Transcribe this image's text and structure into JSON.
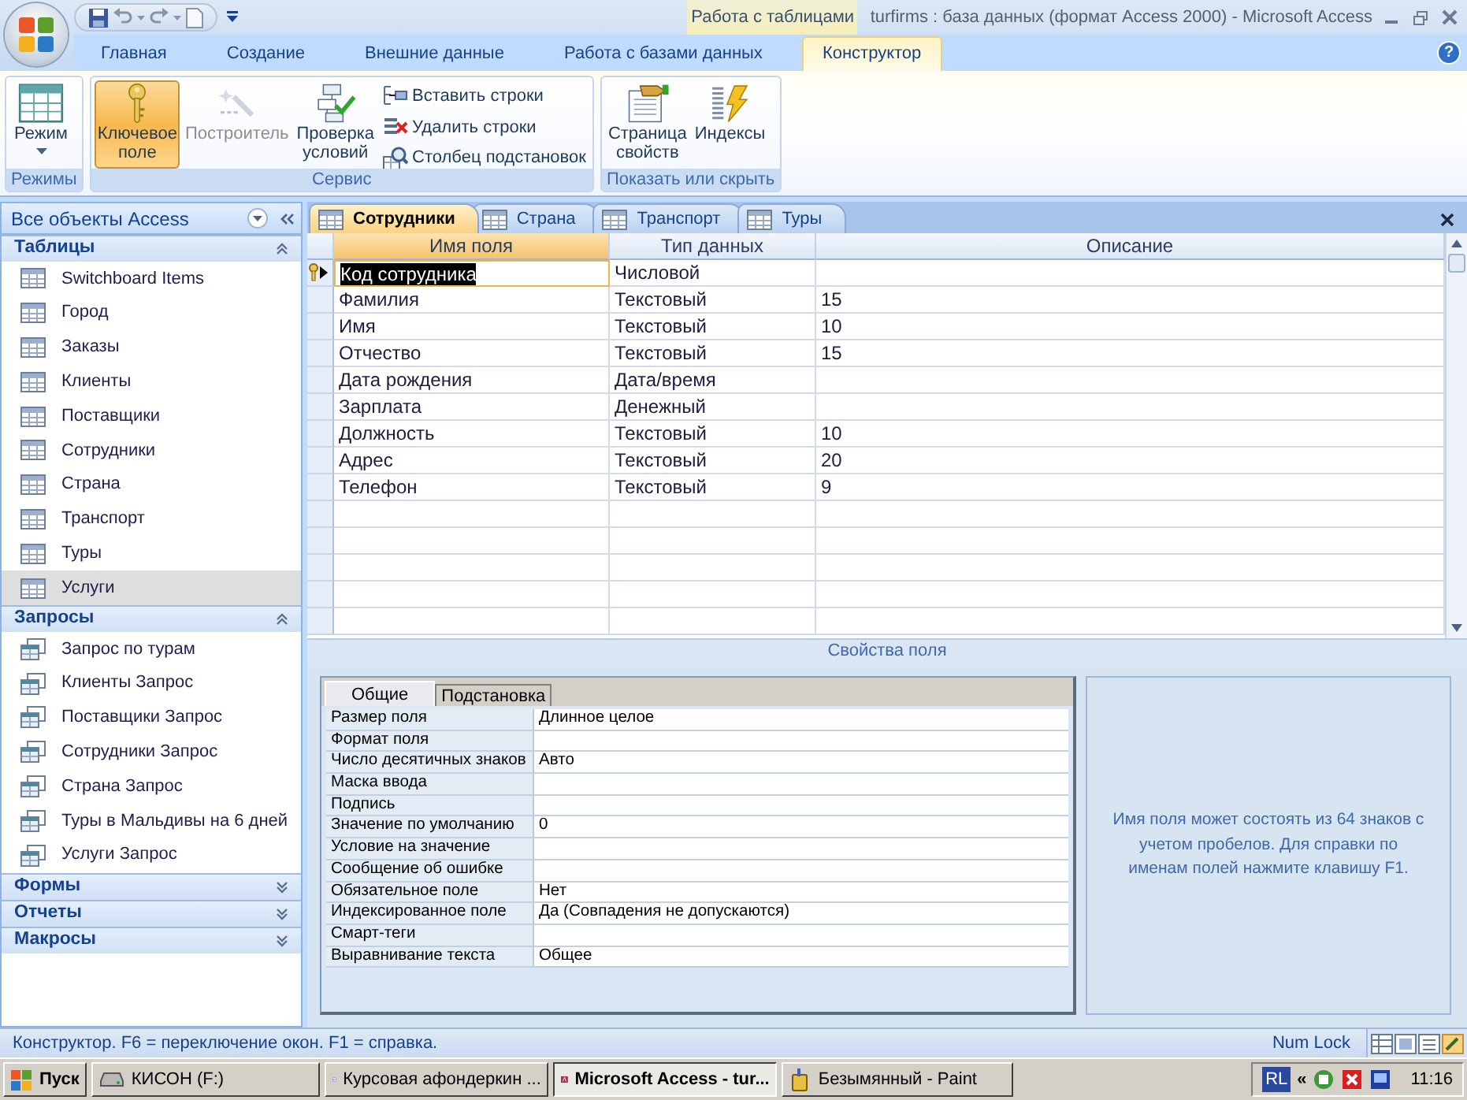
{
  "window": {
    "title": "turfirms : база данных (формат Access 2000) - Microsoft Access",
    "context_group": "Работа с таблицами",
    "help_button": "?"
  },
  "ribbon_tabs": [
    {
      "label": "Главная",
      "selected": false
    },
    {
      "label": "Создание",
      "selected": false
    },
    {
      "label": "Внешние данные",
      "selected": false
    },
    {
      "label": "Работа с базами данных",
      "selected": false
    },
    {
      "label": "Конструктор",
      "selected": true
    }
  ],
  "ribbon_groups": [
    {
      "label": "Режимы",
      "buttons": [
        {
          "label": "Режим",
          "kind": "large",
          "dropdown": true,
          "pressed": false,
          "disabled": false
        }
      ]
    },
    {
      "label": "Сервис",
      "buttons": [
        {
          "label": "Ключевое поле",
          "kind": "large",
          "pressed": true,
          "disabled": false
        },
        {
          "label": "Построитель",
          "kind": "large",
          "pressed": false,
          "disabled": true
        },
        {
          "label": "Проверка условий",
          "kind": "large",
          "pressed": false,
          "disabled": false
        },
        {
          "label": "Вставить строки",
          "kind": "small",
          "pressed": false,
          "disabled": false
        },
        {
          "label": "Удалить строки",
          "kind": "small",
          "pressed": false,
          "disabled": false
        },
        {
          "label": "Столбец подстановок",
          "kind": "small",
          "pressed": false,
          "disabled": false
        }
      ]
    },
    {
      "label": "Показать или скрыть",
      "buttons": [
        {
          "label": "Страница свойств",
          "kind": "large",
          "pressed": false,
          "disabled": false
        },
        {
          "label": "Индексы",
          "kind": "large",
          "pressed": false,
          "disabled": false
        }
      ]
    }
  ],
  "nav_pane": {
    "title": "Все объекты Access",
    "groups": [
      {
        "label": "Таблицы",
        "kind": "table",
        "expanded": true,
        "items": [
          {
            "label": "Switchboard Items",
            "selected": false
          },
          {
            "label": "Город",
            "selected": false
          },
          {
            "label": "Заказы",
            "selected": false
          },
          {
            "label": "Клиенты",
            "selected": false
          },
          {
            "label": "Поставщики",
            "selected": false
          },
          {
            "label": "Сотрудники",
            "selected": false
          },
          {
            "label": "Страна",
            "selected": false
          },
          {
            "label": "Транспорт",
            "selected": false
          },
          {
            "label": "Туры",
            "selected": false
          },
          {
            "label": "Услуги",
            "selected": true
          }
        ]
      },
      {
        "label": "Запросы",
        "kind": "query",
        "expanded": true,
        "items": [
          {
            "label": "Запрос по турам",
            "selected": false
          },
          {
            "label": "Клиенты Запрос",
            "selected": false
          },
          {
            "label": "Поставщики Запрос",
            "selected": false
          },
          {
            "label": "Сотрудники Запрос",
            "selected": false
          },
          {
            "label": "Страна Запрос",
            "selected": false
          },
          {
            "label": "Туры в Мальдивы на 6 дней",
            "selected": false
          },
          {
            "label": "Услуги Запрос",
            "selected": false
          }
        ]
      },
      {
        "label": "Формы",
        "expanded": false
      },
      {
        "label": "Отчеты",
        "expanded": false
      },
      {
        "label": "Макросы",
        "expanded": false
      }
    ]
  },
  "document_tabs": [
    {
      "label": "Сотрудники",
      "selected": true
    },
    {
      "label": "Страна",
      "selected": false
    },
    {
      "label": "Транспорт",
      "selected": false
    },
    {
      "label": "Туры",
      "selected": false
    }
  ],
  "design_grid": {
    "columns": [
      {
        "label": "Имя поля",
        "selected": true
      },
      {
        "label": "Тип данных",
        "selected": false
      },
      {
        "label": "Описание",
        "selected": false
      }
    ],
    "rows": [
      {
        "cells": [
          "Код сотрудника",
          "Числовой",
          ""
        ],
        "primary_key": true,
        "current": true
      },
      {
        "cells": [
          "Фамилия",
          "Текстовый",
          "15"
        ],
        "primary_key": false,
        "current": false
      },
      {
        "cells": [
          "Имя",
          "Текстовый",
          "10"
        ],
        "primary_key": false,
        "current": false
      },
      {
        "cells": [
          "Отчество",
          "Текстовый",
          "15"
        ],
        "primary_key": false,
        "current": false
      },
      {
        "cells": [
          "Дата рождения",
          "Дата/время",
          ""
        ],
        "primary_key": false,
        "current": false
      },
      {
        "cells": [
          "Зарплата",
          "Денежный",
          ""
        ],
        "primary_key": false,
        "current": false
      },
      {
        "cells": [
          "Должность",
          "Текстовый",
          "10"
        ],
        "primary_key": false,
        "current": false
      },
      {
        "cells": [
          "Адрес",
          "Текстовый",
          "20"
        ],
        "primary_key": false,
        "current": false
      },
      {
        "cells": [
          "Телефон",
          "Текстовый",
          "9"
        ],
        "primary_key": false,
        "current": false
      }
    ]
  },
  "field_properties": {
    "title": "Свойства поля",
    "tabs": [
      {
        "label": "Общие",
        "selected": true
      },
      {
        "label": "Подстановка",
        "selected": false
      }
    ],
    "rows": [
      {
        "label": "Размер поля",
        "value": "Длинное целое"
      },
      {
        "label": "Формат поля"
      },
      {
        "label": "Число десятичных знаков",
        "value": "Авто"
      },
      {
        "label": "Маска ввода"
      },
      {
        "label": "Подпись"
      },
      {
        "label": "Значение по умолчанию",
        "value": "0"
      },
      {
        "label": "Условие на значение"
      },
      {
        "label": "Сообщение об ошибке"
      },
      {
        "label": "Обязательное поле",
        "value": "Нет"
      },
      {
        "label": "Индексированное поле",
        "value": "Да (Совпадения не допускаются)"
      },
      {
        "label": "Смарт-теги"
      },
      {
        "label": "Выравнивание текста",
        "value": "Общее"
      }
    ],
    "help": "Имя поля может состоять из 64 знаков с учетом пробелов.  Для справки по именам полей нажмите клавишу F1."
  },
  "status_bar": {
    "text": "Конструктор.  F6 = переключение окон.  F1 = справка.",
    "indicator": "Num Lock"
  },
  "taskbar": {
    "start": "Пуск",
    "tasks": [
      {
        "label": "КИСОН (F:)",
        "selected": false
      },
      {
        "label": "Курсовая афондеркин ...",
        "selected": false
      },
      {
        "label": "Microsoft Access - tur...",
        "selected": true
      },
      {
        "label": "Безымянный - Paint",
        "selected": false
      }
    ],
    "language": "RL",
    "expand": "«",
    "clock": "11:16"
  }
}
